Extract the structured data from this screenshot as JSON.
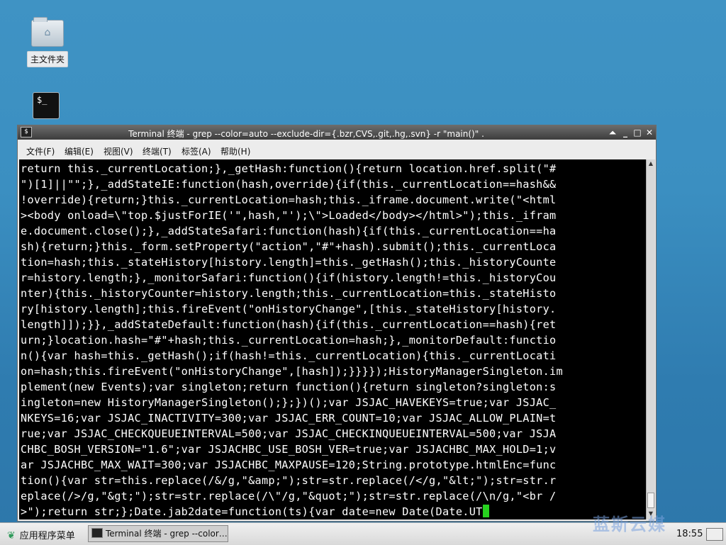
{
  "desktop": {
    "home_label": "主文件夹",
    "terminal_icon_glyph": "$_"
  },
  "window": {
    "title": "Terminal 终端 - grep --color=auto --exclude-dir={.bzr,CVS,.git,.hg,.svn} -r \"main()\" .",
    "icon_glyph": "$",
    "buttons": {
      "shade": "⏶",
      "minimize": "_",
      "maximize": "□",
      "close": "✕"
    },
    "menu": [
      "文件(F)",
      "编辑(E)",
      "视图(V)",
      "终端(T)",
      "标签(A)",
      "帮助(H)"
    ],
    "terminal_lines": [
      "return this._currentLocation;},_getHash:function(){return location.href.split(\"#",
      "\")[1]||\"\";},_addStateIE:function(hash,override){if(this._currentLocation==hash&&",
      "!override){return;}this._currentLocation=hash;this._iframe.document.write(\"<html",
      "><body onload=\\\"top.$justForIE('\",hash,\"');\\\">Loaded</body></html>\");this._ifram",
      "e.document.close();},_addStateSafari:function(hash){if(this._currentLocation==ha",
      "sh){return;}this._form.setProperty(\"action\",\"#\"+hash).submit();this._currentLoca",
      "tion=hash;this._stateHistory[history.length]=this._getHash();this._historyCounte",
      "r=history.length;},_monitorSafari:function(){if(history.length!=this._historyCou",
      "nter){this._historyCounter=history.length;this._currentLocation=this._stateHisto",
      "ry[history.length];this.fireEvent(\"onHistoryChange\",[this._stateHistory[history.",
      "length]]);}},_addStateDefault:function(hash){if(this._currentLocation==hash){ret",
      "urn;}location.hash=\"#\"+hash;this._currentLocation=hash;},_monitorDefault:functio",
      "n(){var hash=this._getHash();if(hash!=this._currentLocation){this._currentLocati",
      "on=hash;this.fireEvent(\"onHistoryChange\",[hash]);}}}});HistoryManagerSingleton.im",
      "plement(new Events);var singleton;return function(){return singleton?singleton:s",
      "ingleton=new HistoryManagerSingleton();};})();var JSJAC_HAVEKEYS=true;var JSJAC_",
      "NKEYS=16;var JSJAC_INACTIVITY=300;var JSJAC_ERR_COUNT=10;var JSJAC_ALLOW_PLAIN=t",
      "rue;var JSJAC_CHECKQUEUEINTERVAL=500;var JSJAC_CHECKINQUEUEINTERVAL=500;var JSJA",
      "CHBC_BOSH_VERSION=\"1.6\";var JSJACHBC_USE_BOSH_VER=true;var JSJACHBC_MAX_HOLD=1;v",
      "ar JSJACHBC_MAX_WAIT=300;var JSJACHBC_MAXPAUSE=120;String.prototype.htmlEnc=func",
      "tion(){var str=this.replace(/&/g,\"&amp;\");str=str.replace(/</g,\"&lt;\");str=str.r",
      "eplace(/>/g,\"&gt;\");str=str.replace(/\\\"/g,\"&quot;\");str=str.replace(/\\n/g,\"<br /",
      ">\");return str;};Date.jab2date=function(ts){var date=new Date(Date.UT"
    ]
  },
  "taskbar": {
    "app_menu_label": "应用程序菜单",
    "task_label": "Terminal 终端 - grep --color…",
    "clock": "18:55"
  },
  "watermark": "蓝斯云媒"
}
